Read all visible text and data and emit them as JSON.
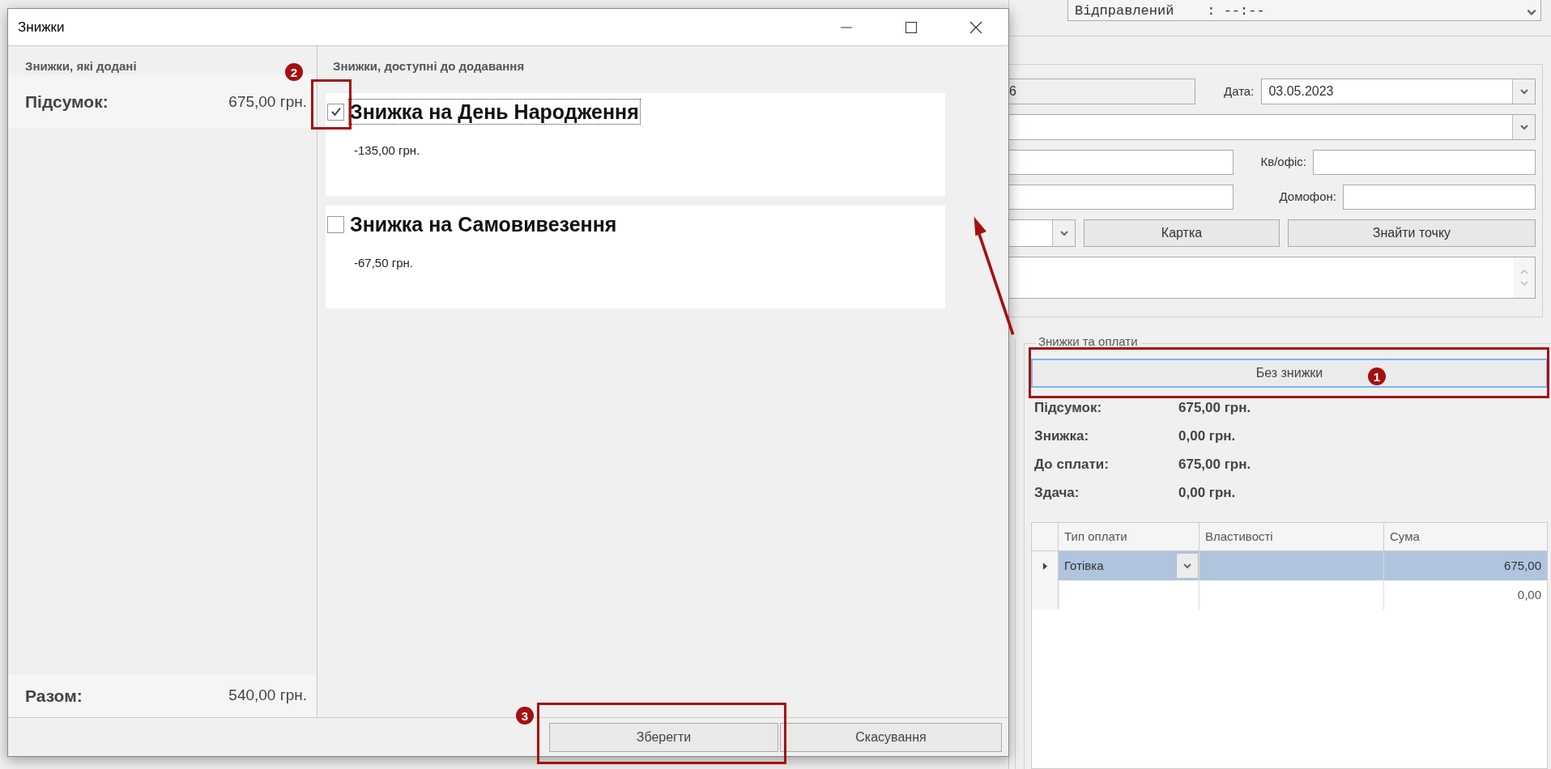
{
  "background_app": {
    "top_bar": {
      "sent_field": "Відправлений    : --:--"
    },
    "order_form": {
      "number_field": "6",
      "date_label": "Дата:",
      "date_value": "03.05.2023",
      "apartment_label": "Кв/офіс:",
      "intercom_label": "Домофон:",
      "buttons": [
        "Картка",
        "Знайти точку"
      ]
    },
    "payments": {
      "group_title": "Знижки та оплати",
      "discount_button": "Без знижки",
      "summary": [
        {
          "label": "Підсумок:",
          "value": "675,00 грн."
        },
        {
          "label": "Знижка:",
          "value": "0,00 грн."
        },
        {
          "label": "До сплати:",
          "value": "675,00 грн."
        },
        {
          "label": "Здача:",
          "value": "0,00 грн."
        }
      ],
      "table": {
        "columns": [
          "Тип оплати",
          "Властивості",
          "Сума"
        ],
        "rows": [
          {
            "type": "Готівка",
            "amount": "675,00",
            "selected": true
          },
          {
            "amount": "0,00",
            "selected": false
          }
        ]
      }
    }
  },
  "dialog": {
    "title": "Знижки",
    "applied": {
      "heading": "Знижки, які додані",
      "subtotal_label": "Підсумок:",
      "subtotal_value": "675,00 грн.",
      "total_label": "Разом:",
      "total_value": "540,00 грн."
    },
    "available": {
      "heading": "Знижки, доступні до додавання",
      "discounts": [
        {
          "name": "Знижка на День Народження",
          "amount": "-135,00 грн.",
          "checked": true,
          "focused": true
        },
        {
          "name": "Знижка на Самовивезення",
          "amount": "-67,50 грн.",
          "checked": false,
          "focused": false
        }
      ]
    },
    "buttons": [
      "Зберегти",
      "Скасування"
    ]
  },
  "annotations": [
    {
      "label": "1"
    },
    {
      "label": "2"
    },
    {
      "label": "3"
    }
  ]
}
